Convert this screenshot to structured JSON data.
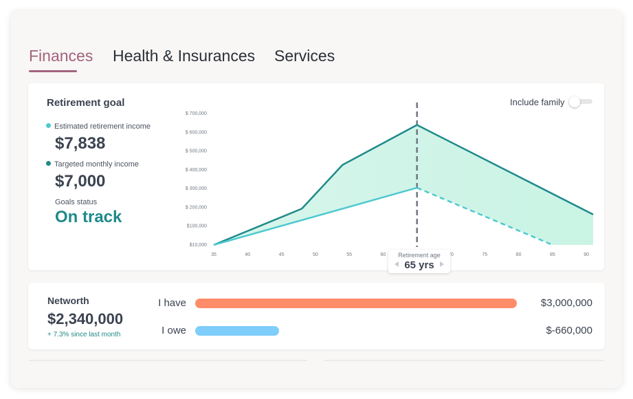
{
  "tabs": [
    {
      "label": "Finances",
      "active": true
    },
    {
      "label": "Health & Insurances",
      "active": false
    },
    {
      "label": "Services",
      "active": false
    }
  ],
  "retirement": {
    "title": "Retirement goal",
    "estimated_label": "Estimated retirement income",
    "estimated_value": "$7,838",
    "targeted_label": "Targeted monthly income",
    "targeted_value": "$7,000",
    "goals_label": "Goals status",
    "goals_status": "On track",
    "include_family_label": "Include family",
    "include_family_on": false,
    "retirement_age_label": "Retirement age",
    "retirement_age_value": "65 yrs"
  },
  "colors": {
    "accent_tab": "#a3627c",
    "estimated_dot": "#4ec9cf",
    "targeted_dot": "#1f8a8a",
    "status_green": "#1f8a8a",
    "i_have_bar": "#ff8c69",
    "i_owe_bar": "#7fcdfa",
    "area_fill": "#c9f4e4"
  },
  "chart_data": {
    "type": "line",
    "y_tick_labels": [
      "$ 700,000",
      "$ 600,000",
      "$ 500,000",
      "$ 400,000",
      "$ 300,000",
      "$ 200,000",
      "$100,000",
      "$10,000"
    ],
    "x_tick_labels": [
      "35",
      "40",
      "45",
      "50",
      "55",
      "60",
      "65",
      "70",
      "75",
      "80",
      "85",
      "90"
    ],
    "series": [
      {
        "color": "#1f8a8a",
        "style": "solid",
        "points": [
          [
            35,
            10000
          ],
          [
            48,
            200000
          ],
          [
            54,
            430000
          ],
          [
            65,
            640000
          ],
          [
            91,
            170000
          ]
        ]
      },
      {
        "color": "#4ec9cf",
        "style": "solid-then-dashed",
        "points": [
          [
            35,
            10000
          ],
          [
            65,
            310000
          ],
          [
            85,
            10000
          ]
        ]
      }
    ],
    "retirement_marker_x": 65,
    "area_between_series": true
  },
  "networth": {
    "title": "Networth",
    "value": "$2,340,000",
    "change": "+ 7.3% since last month",
    "have_label": "I have",
    "have_amount": "$3,000,000",
    "have_fraction": 1.0,
    "owe_label": "I owe",
    "owe_amount": "$-660,000",
    "owe_fraction": 0.26
  }
}
